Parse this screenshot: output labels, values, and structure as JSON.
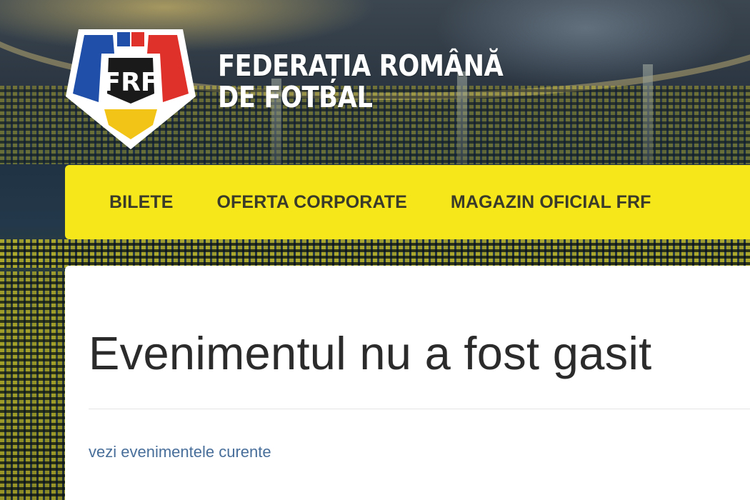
{
  "header": {
    "logo_text": "FRF",
    "org_name_line1": "FEDERAȚIA ROMÂNĂ",
    "org_name_line2": "DE FOTBAL"
  },
  "nav": {
    "items": [
      {
        "label": "BILETE"
      },
      {
        "label": "OFERTA CORPORATE"
      },
      {
        "label": "MAGAZIN OFICIAL FRF"
      }
    ]
  },
  "main": {
    "title": "Evenimentul nu a fost gasit",
    "link_label": "vezi evenimentele curente"
  },
  "colors": {
    "nav_background": "#f5e71a",
    "nav_text": "#3b3b2a",
    "title_text": "#2b2b2b",
    "link_text": "#486e9a",
    "logo_blue": "#1f4fa8",
    "logo_red": "#e0302a",
    "logo_yellow": "#f2c417"
  }
}
